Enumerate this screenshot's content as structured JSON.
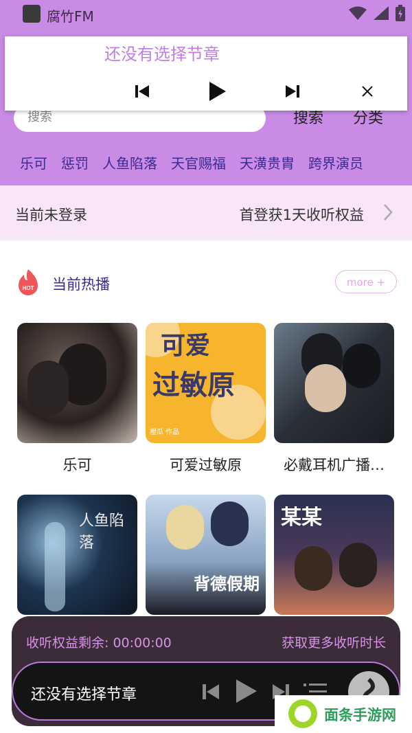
{
  "status_bar": {
    "app_name": "腐竹FM"
  },
  "header": {
    "search_placeholder": "搜索",
    "search_button": "搜索",
    "category_button": "分类",
    "tags": [
      "乐可",
      "惩罚",
      "人鱼陷落",
      "天官赐福",
      "天潢贵胄",
      "跨界演员"
    ]
  },
  "mini_player": {
    "title": "还没有选择节章"
  },
  "login_bar": {
    "status": "当前未登录",
    "promo": "首登获1天收听权益"
  },
  "hot_section": {
    "badge": "HOT",
    "title": "当前热播",
    "more_label": "more +",
    "items": [
      {
        "title": "乐可"
      },
      {
        "title": "可爱过敏原"
      },
      {
        "title": "必戴耳机广播…"
      },
      {
        "title": ""
      },
      {
        "title": ""
      },
      {
        "title": ""
      }
    ],
    "cover_texts": {
      "item2_line1": "可爱",
      "item2_line2": "过敏原",
      "item2_label": "橙瓜 作品",
      "item4_title": "人鱼陷落",
      "item5_title": "背德假期",
      "item6_title": "某某"
    }
  },
  "bottom_panel": {
    "remaining": "收听权益剩余: 00:00:00",
    "get_more": "获取更多收听时长"
  },
  "bottom_player": {
    "title": "还没有选择节章"
  },
  "watermark": {
    "text": "面条手游网"
  },
  "colors": {
    "accent": "#c98be6",
    "tag_text": "#3b2a90",
    "panel": "#3c2c3a"
  }
}
